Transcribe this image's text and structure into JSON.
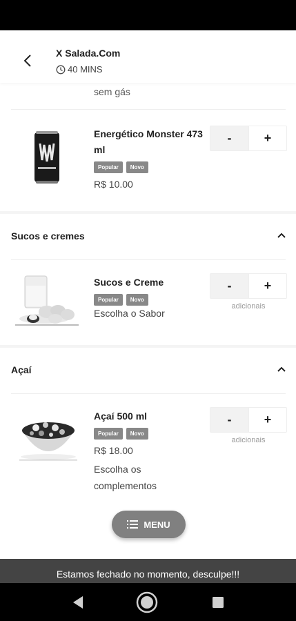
{
  "header": {
    "store_name": "X Salada.Com",
    "delivery_time": "40 MINS"
  },
  "previous_item": {
    "description": "sem gás"
  },
  "products": [
    {
      "name": "Energético Monster 473 ml",
      "badges": [
        "Popular",
        "Novo"
      ],
      "price": "R$ 10.00",
      "description": "",
      "minus": "-",
      "plus": "+",
      "note": ""
    },
    {
      "name": "Sucos e Creme",
      "badges": [
        "Popular",
        "Novo"
      ],
      "price": "",
      "description": "Escolha o Sabor",
      "minus": "-",
      "plus": "+",
      "note": "adicionais"
    },
    {
      "name": "Açaí 500 ml",
      "badges": [
        "Popular",
        "Novo"
      ],
      "price": "R$ 18.00",
      "description": "Escolha os complementos",
      "minus": "-",
      "plus": "+",
      "note": "adicionais"
    }
  ],
  "sections": [
    {
      "title": "Sucos e cremes"
    },
    {
      "title": "Açaí"
    }
  ],
  "menu_button": {
    "label": "MENU"
  },
  "closed_notice": "Estamos fechado no momento, desculpe!!!",
  "colors": {
    "badge": "#888888",
    "fab": "#808080",
    "closed_bar": "#444444"
  },
  "icons": [
    "back-arrow-icon",
    "clock-icon",
    "chevron-up-icon",
    "menu-list-icon",
    "nav-back-icon",
    "nav-home-icon",
    "nav-recents-icon"
  ]
}
